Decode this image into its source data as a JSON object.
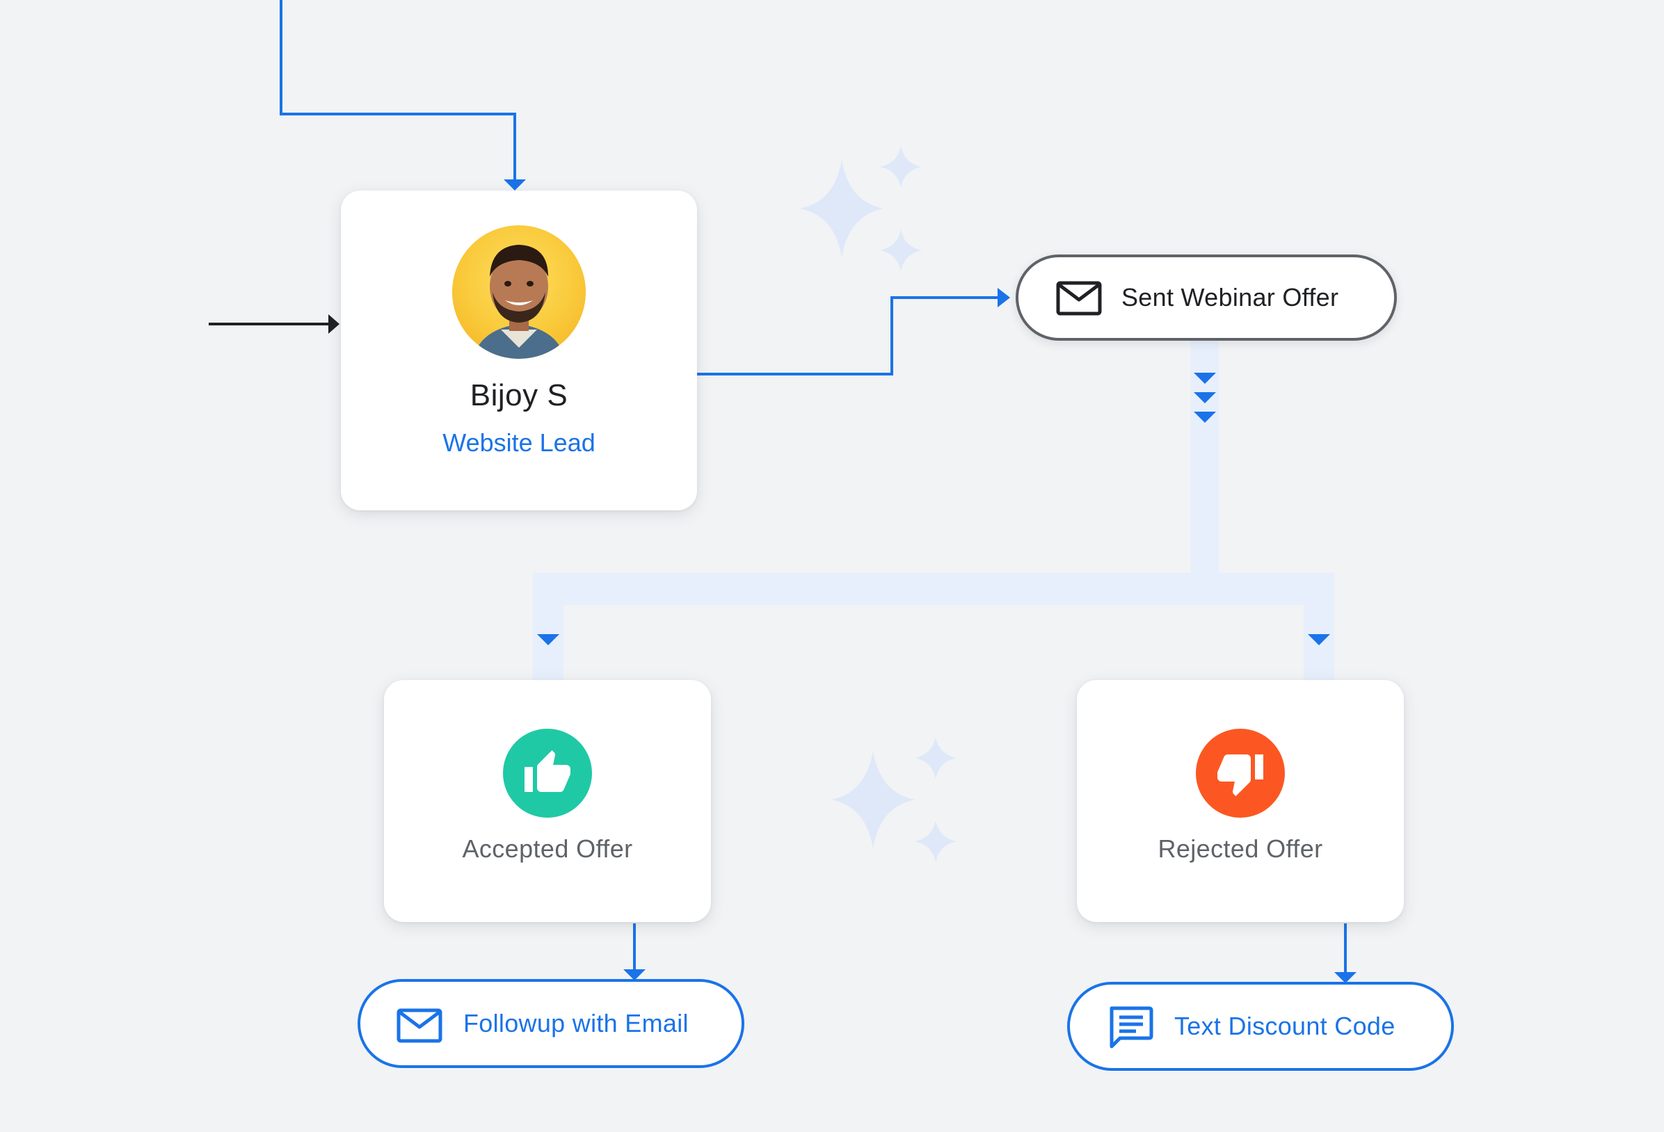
{
  "lead": {
    "name": "Bijoy S",
    "subtitle": "Website Lead"
  },
  "actions": {
    "webinar": "Sent Webinar Offer",
    "email": "Followup with Email",
    "text": "Text Discount Code"
  },
  "outcomes": {
    "accepted": "Accepted Offer",
    "rejected": "Rejected Offer"
  },
  "icons": {
    "lead_avatar": "person-avatar",
    "webinar": "mail-icon",
    "email": "mail-icon",
    "text": "chat-message-icon",
    "accepted": "thumbs-up-icon",
    "rejected": "thumbs-down-icon",
    "decoration": "sparkle-icon"
  },
  "colors": {
    "background": "#f1f3f5",
    "accent_blue": "#1a73e8",
    "branch_tint": "#e7effd",
    "accepted": "#1fc9a5",
    "rejected": "#fc5722",
    "text_primary": "#202124",
    "text_secondary": "#5f6368"
  }
}
